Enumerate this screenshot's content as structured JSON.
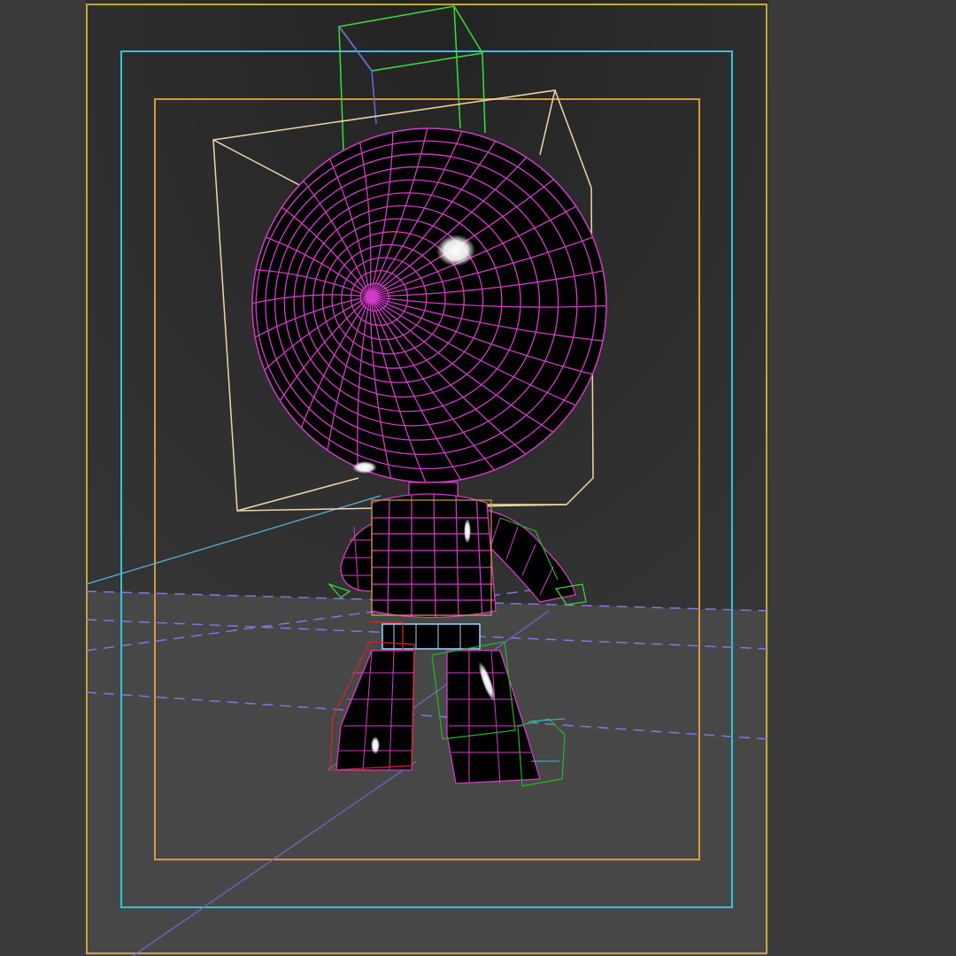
{
  "viewport": {
    "label": "",
    "render_mode": "shaded-with-wireframe",
    "background_color": "#262626",
    "ground_color": "#4a4a4a",
    "side_panel_color": "#3a3a3a"
  },
  "guides": {
    "render_frame_color": "#c8a53a",
    "action_safe_color": "#2ec7d6",
    "title_safe_color": "#d29a3c",
    "horizon_line_color": "#7878e0"
  },
  "character": {
    "name": "",
    "mesh_color": "#000000",
    "wire_color": "#d43cc8",
    "head_gizmo_color": "#f2d6a8",
    "antenna_gizmo_color": "#3cdc3c",
    "left_leg_gizmo_color": "#dc2828",
    "right_leg_gizmo_color": "#28b428",
    "belt_gizmo_color": "#9ad7ff"
  },
  "icons": {
    "wire_head": "sphere-wire-icon"
  }
}
